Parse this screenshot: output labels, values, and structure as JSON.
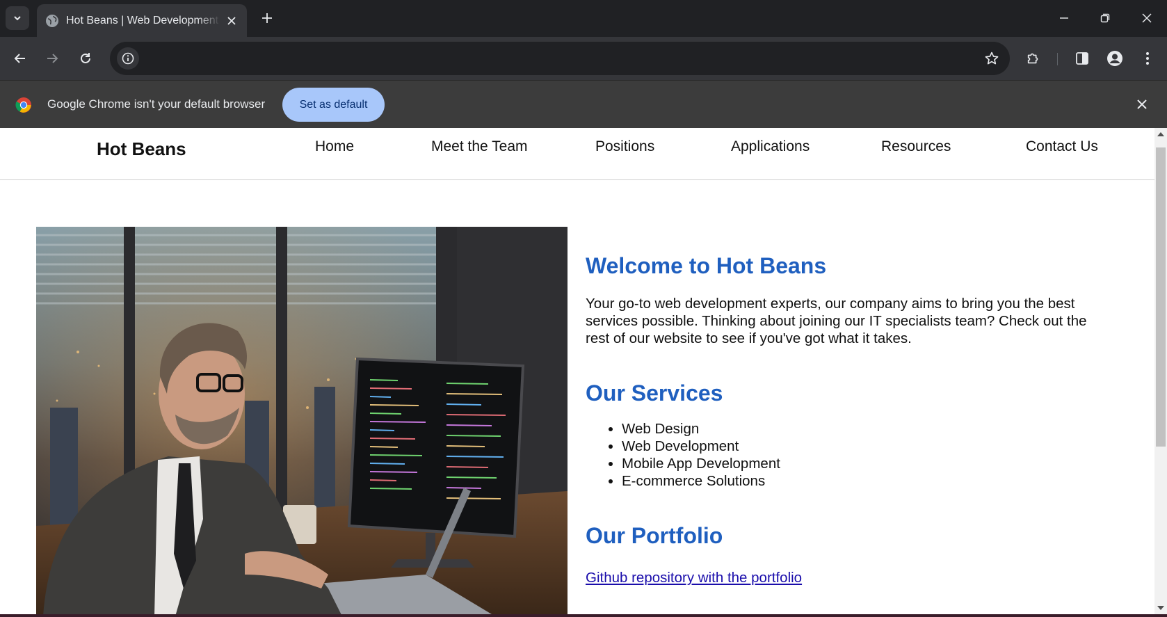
{
  "browser": {
    "tab_title": "Hot Beans | Web Development",
    "infobar_message": "Google Chrome isn't your default browser",
    "infobar_button": "Set as default"
  },
  "site": {
    "brand": "Hot Beans",
    "nav": [
      "Home",
      "Meet the Team",
      "Positions",
      "Applications",
      "Resources",
      "Contact Us"
    ],
    "welcome_title": "Welcome to Hot Beans",
    "welcome_text": "Your go-to web development experts, our company aims to bring you the best services possible. Thinking about joining our IT specialists team? Check out the rest of our website to see if you've got what it takes.",
    "services_title": "Our Services",
    "services": [
      "Web Design",
      "Web Development",
      "Mobile App Development",
      "E-commerce Solutions"
    ],
    "portfolio_title": "Our Portfolio",
    "portfolio_link": "Github repository with the portfolio"
  },
  "colors": {
    "heading_blue": "#1f5fbf",
    "link_blue": "#1a0dab",
    "infobar_button": "#a8c7fa"
  }
}
